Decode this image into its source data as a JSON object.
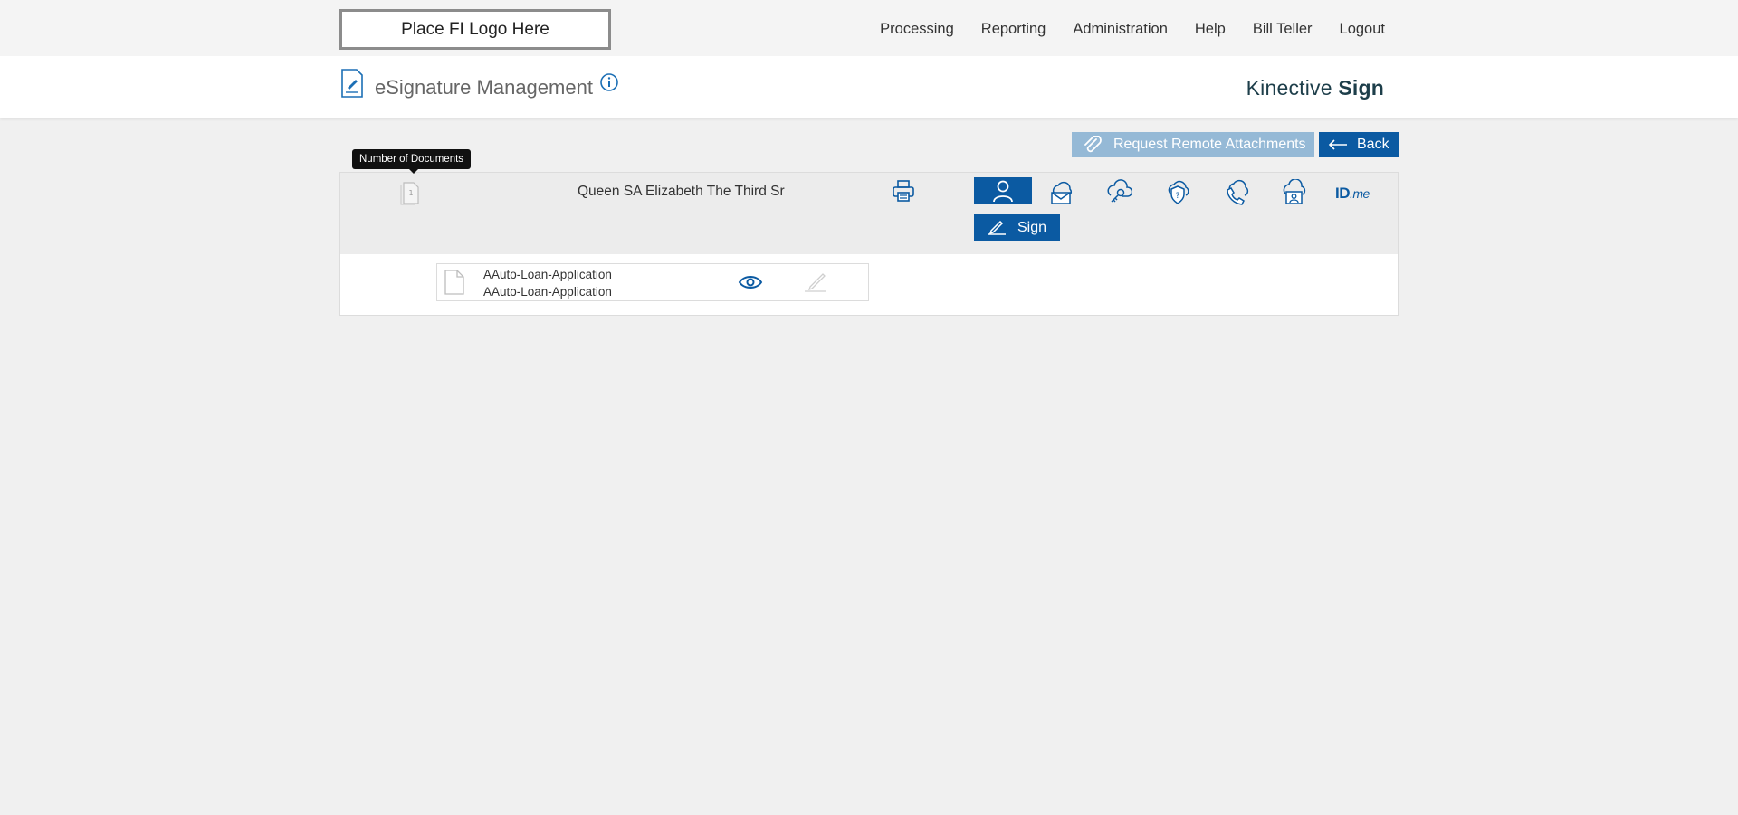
{
  "topbar": {
    "logo_placeholder": "Place FI Logo Here",
    "nav": [
      "Processing",
      "Reporting",
      "Administration",
      "Help",
      "Bill Teller",
      "Logout"
    ]
  },
  "header": {
    "title": "eSignature Management",
    "brand_light": "Kinective",
    "brand_bold": "Sign"
  },
  "actions": {
    "request_attachments_label": "Request Remote Attachments",
    "back_label": "Back"
  },
  "signer": {
    "tooltip": "Number of Documents",
    "document_count": "1",
    "name": "Queen SA Elizabeth The Third Sr",
    "sign_label": "Sign",
    "idme_label_main": "ID",
    "idme_label_suffix": ".me"
  },
  "documents": [
    {
      "line1": "AAuto-Loan-Application",
      "line2": "AAuto-Loan-Application"
    }
  ],
  "colors": {
    "primary": "#0b5aa2",
    "primary_disabled": "#95b9d6",
    "brand_text": "#1d3e4a"
  }
}
